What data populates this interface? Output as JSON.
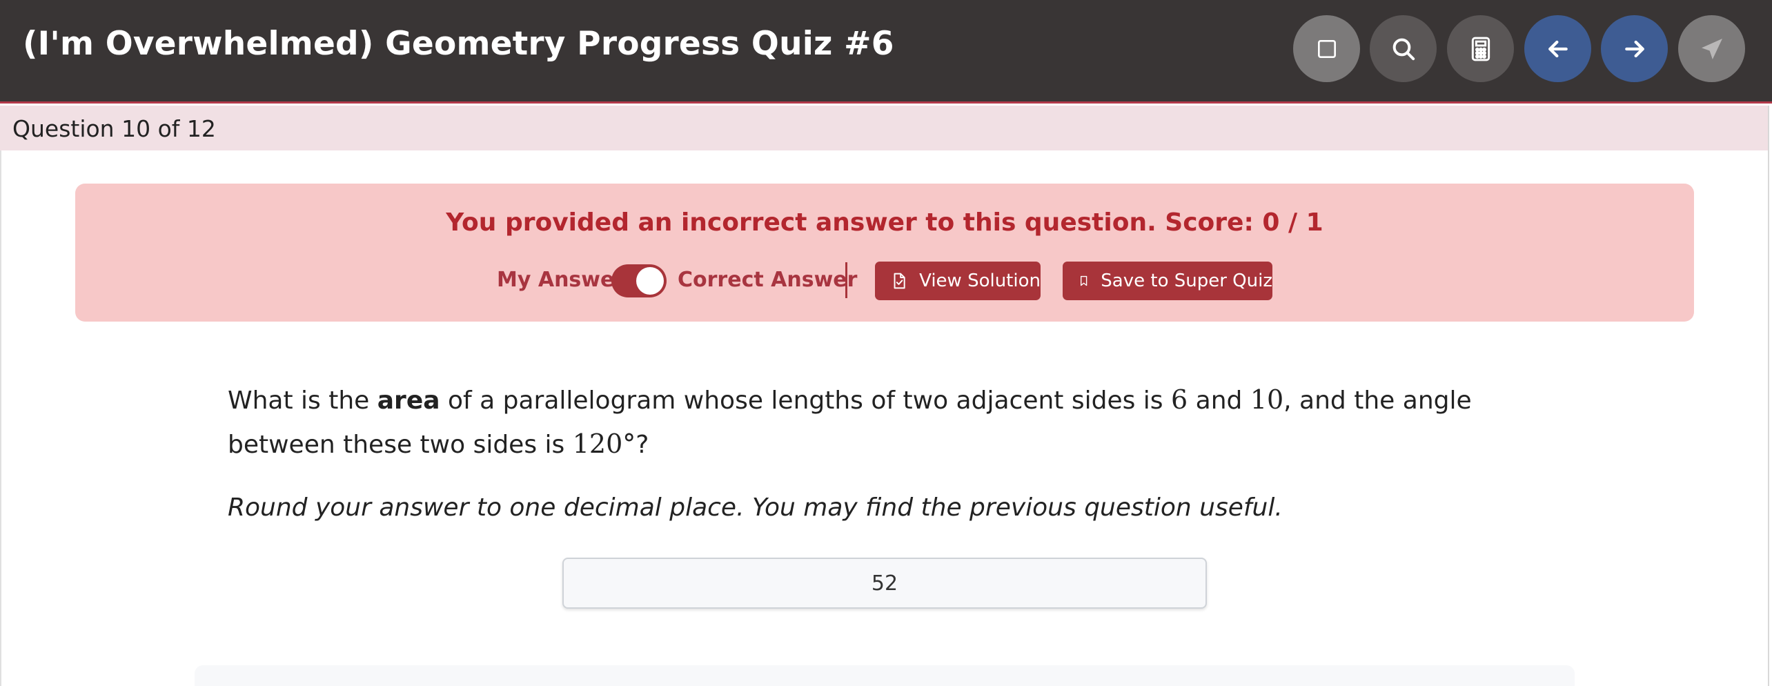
{
  "header": {
    "title": "(I'm Overwhelmed) Geometry Progress Quiz #6",
    "icons": [
      "square-icon",
      "search-icon",
      "calculator-icon",
      "arrow-left-icon",
      "arrow-right-icon",
      "send-icon"
    ]
  },
  "progress": {
    "label": "Question 10 of 12"
  },
  "feedback": {
    "message": "You provided an incorrect answer to this question. Score: 0 / 1",
    "my_answer_label": "My Answer",
    "correct_answer_label": "Correct Answer",
    "toggle_on": true,
    "view_solution_label": "View Solution",
    "save_label": "Save to Super Quiz"
  },
  "question": {
    "part1": "What is the ",
    "bold": "area",
    "part2": " of a parallelogram whose lengths of two adjacent sides is ",
    "side_a": "6",
    "part3": " and ",
    "side_b": "10",
    "part4": ", and the angle between these two sides is ",
    "angle": "120°",
    "part5": "?",
    "instruction": "Round your answer to one decimal place. You may find the previous question useful."
  },
  "answer": {
    "value": "52"
  },
  "colors": {
    "header_bg": "#393535",
    "nav_blue": "#3e5c93",
    "alert_bg": "#f7c8c8",
    "alert_text": "#b3262e",
    "button_red": "#a8343a",
    "progress_bg": "#f1e0e4"
  }
}
